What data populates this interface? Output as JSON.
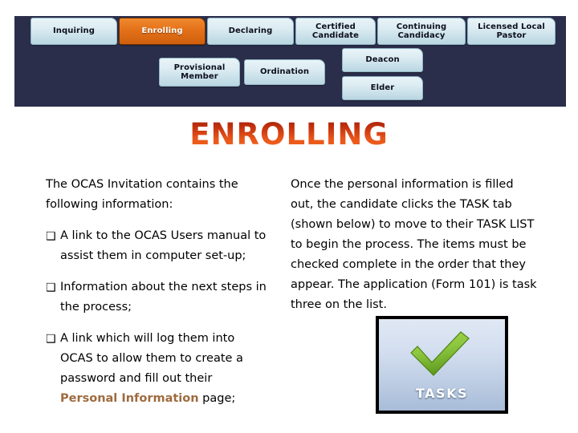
{
  "nav": {
    "row1": [
      {
        "label": "Inquiring",
        "active": false
      },
      {
        "label": "Enrolling",
        "active": true
      },
      {
        "label": "Declaring",
        "active": false
      },
      {
        "label": "Certified\nCandidate",
        "active": false
      },
      {
        "label": "Continuing\nCandidacy",
        "active": false
      },
      {
        "label": "Licensed Local\nPastor",
        "active": false
      }
    ],
    "row2": [
      {
        "label": "Provisional\nMember"
      },
      {
        "label": "Ordination"
      },
      {
        "label": "Deacon"
      },
      {
        "label": "Elder"
      }
    ]
  },
  "title": "ENROLLING",
  "left_column": {
    "intro": "The OCAS Invitation contains the following information:",
    "bullet_glyph": "❑",
    "bullets": [
      "A link to the OCAS Users manual to assist them in computer set-up;",
      "Information about the next steps in the process;"
    ],
    "bullet3_part1": "A link which will log them into OCAS to allow them to create a password and fill out their ",
    "bullet3_highlight": "Personal Information",
    "bullet3_part2": " page;"
  },
  "right_column": {
    "paragraph": "Once the personal information is filled out, the candidate clicks the TASK tab (shown below) to move to their TASK LIST to begin the process. The items must be checked complete in the order that they appear. The application (Form 101) is task three on the list."
  },
  "tasks_button": {
    "label": "TASKS",
    "check_color": "#8cc63f",
    "check_color_dark": "#5f9a1e"
  },
  "colors": {
    "nav_band": "#2b2e4a",
    "tab_face": "#dcecf2",
    "active_tab": "#e4711a",
    "title_gradient_start": "#9e1b0a",
    "title_gradient_end": "#f26a20",
    "highlight_text": "#9e6b3f"
  }
}
